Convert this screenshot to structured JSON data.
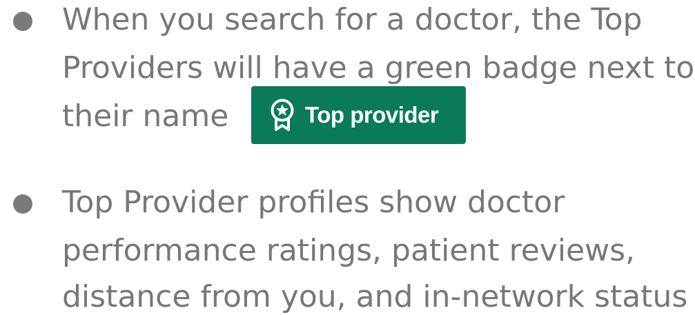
{
  "bullets": [
    {
      "lines": [
        "When you search for a doctor, the Top",
        "Providers will have a green badge next to",
        "their name"
      ],
      "badge": {
        "label": "Top provider",
        "icon": "award-ribbon-star-icon",
        "color": "#0b7a5a"
      }
    },
    {
      "lines": [
        "Top Provider profiles show doctor",
        "performance ratings, patient reviews,",
        "distance from you, and in-network status"
      ]
    }
  ]
}
